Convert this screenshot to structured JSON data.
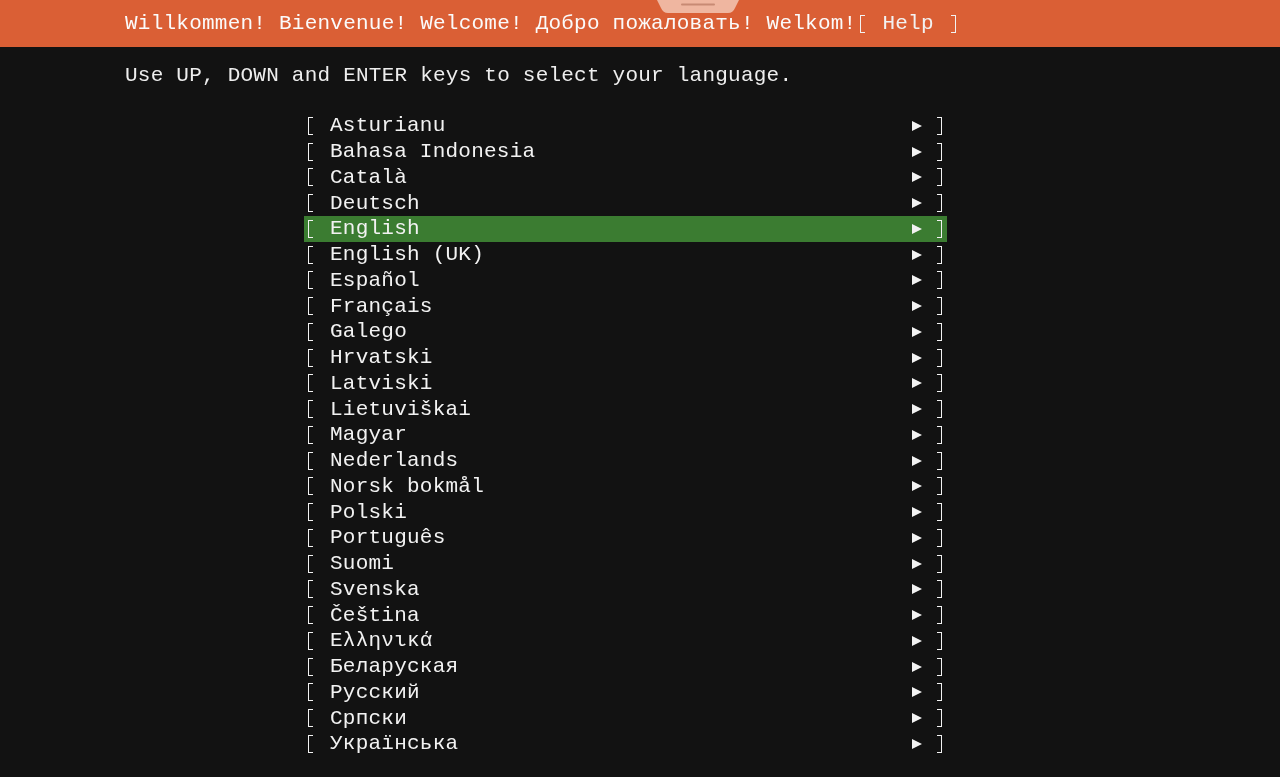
{
  "header": {
    "title": "Willkommen! Bienvenue! Welcome! Добро пожаловать! Welkom!",
    "help_button": "Help"
  },
  "instructions": "Use UP, DOWN and ENTER keys to select your language.",
  "languages": [
    {
      "label": "Asturianu",
      "selected": false
    },
    {
      "label": "Bahasa Indonesia",
      "selected": false
    },
    {
      "label": "Català",
      "selected": false
    },
    {
      "label": "Deutsch",
      "selected": false
    },
    {
      "label": "English",
      "selected": true
    },
    {
      "label": "English (UK)",
      "selected": false
    },
    {
      "label": "Español",
      "selected": false
    },
    {
      "label": "Français",
      "selected": false
    },
    {
      "label": "Galego",
      "selected": false
    },
    {
      "label": "Hrvatski",
      "selected": false
    },
    {
      "label": "Latviski",
      "selected": false
    },
    {
      "label": "Lietuviškai",
      "selected": false
    },
    {
      "label": "Magyar",
      "selected": false
    },
    {
      "label": "Nederlands",
      "selected": false
    },
    {
      "label": "Norsk bokmål",
      "selected": false
    },
    {
      "label": "Polski",
      "selected": false
    },
    {
      "label": "Português",
      "selected": false
    },
    {
      "label": "Suomi",
      "selected": false
    },
    {
      "label": "Svenska",
      "selected": false
    },
    {
      "label": "Čeština",
      "selected": false
    },
    {
      "label": "Ελληνικά",
      "selected": false
    },
    {
      "label": "Беларуская",
      "selected": false
    },
    {
      "label": "Русский",
      "selected": false
    },
    {
      "label": "Српски",
      "selected": false
    },
    {
      "label": "Українська",
      "selected": false
    }
  ]
}
